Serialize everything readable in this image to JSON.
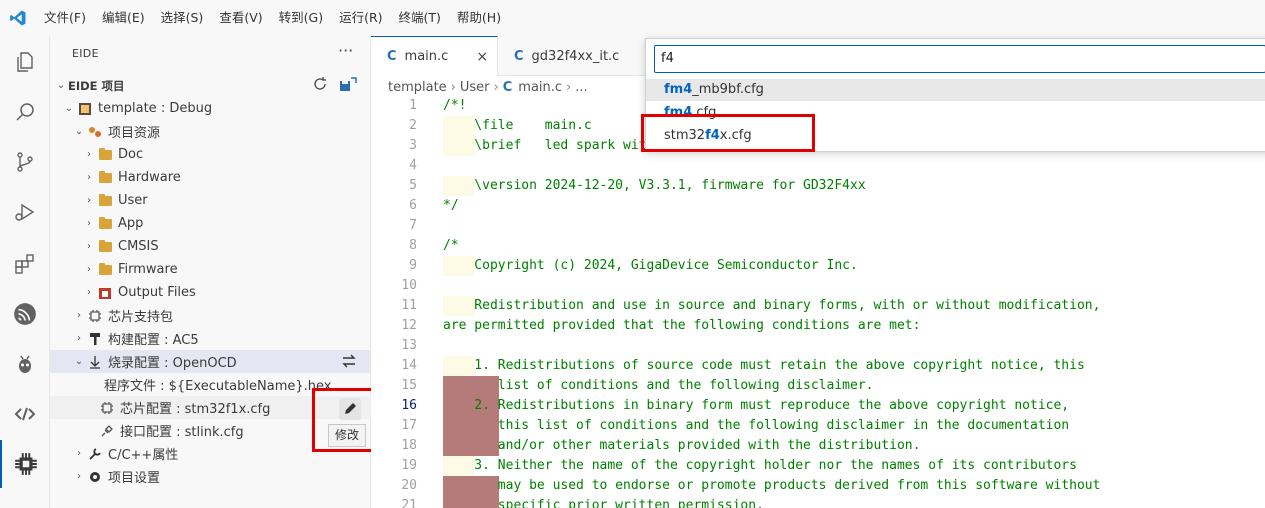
{
  "menubar": {
    "items": [
      "文件(F)",
      "编辑(E)",
      "选择(S)",
      "查看(V)",
      "转到(G)",
      "运行(R)",
      "终端(T)",
      "帮助(H)"
    ]
  },
  "activity_icons": [
    "explorer-icon",
    "search-icon",
    "source-control-icon",
    "run-debug-icon",
    "extensions-icon",
    "esp-icon",
    "bug-icon",
    "code-icon",
    "eide-icon"
  ],
  "sidebar": {
    "title": "EIDE",
    "more": "···",
    "section": "EIDE 项目",
    "project": "template : Debug",
    "resources": "项目资源",
    "folders": [
      "Doc",
      "Hardware",
      "User",
      "App",
      "CMSIS",
      "Firmware",
      "Output Files"
    ],
    "chip_pkg": "芯片支持包",
    "build_cfg": "构建配置 : AC5",
    "flash_cfg": "烧录配置 : OpenOCD",
    "program_file": "程序文件 : ${ExecutableName}.hex",
    "chip_cfg": "芯片配置 : stm32f1x.cfg",
    "iface_cfg": "接口配置 : stlink.cfg",
    "cpp_props": "C/C++属性",
    "project_settings": "项目设置",
    "edit_tooltip": "修改"
  },
  "tabs": [
    {
      "label": "main.c",
      "close": "×"
    },
    {
      "label": "gd32f4xx_it.c"
    }
  ],
  "breadcrumb": [
    "template",
    "User",
    "main.c",
    "..."
  ],
  "quickpick": {
    "value": "f4",
    "items": [
      {
        "pre": "",
        "hl": "fm4",
        "post": "_mb9bf.cfg"
      },
      {
        "pre": "",
        "hl": "fm4",
        "post": ".cfg"
      },
      {
        "pre": "stm32",
        "hl": "f4",
        "post": "x.cfg"
      }
    ]
  },
  "code": {
    "current_line": 16,
    "lines": [
      "/*!",
      "    \\file    main.c",
      "    \\brief   led spark with systick",
      "",
      "    \\version 2024-12-20, V3.3.1, firmware for GD32F4xx",
      "*/",
      "",
      "/*",
      "    Copyright (c) 2024, GigaDevice Semiconductor Inc.",
      "",
      "    Redistribution and use in source and binary forms, with or without modification,",
      "are permitted provided that the following conditions are met:",
      "",
      "    1. Redistributions of source code must retain the above copyright notice, this",
      "       list of conditions and the following disclaimer.",
      "    2. Redistributions in binary form must reproduce the above copyright notice,",
      "       this list of conditions and the following disclaimer in the documentation",
      "       and/or other materials provided with the distribution.",
      "    3. Neither the name of the copyright holder nor the names of its contributors",
      "       may be used to endorse or promote products derived from this software without",
      "       specific prior written permission."
    ]
  }
}
